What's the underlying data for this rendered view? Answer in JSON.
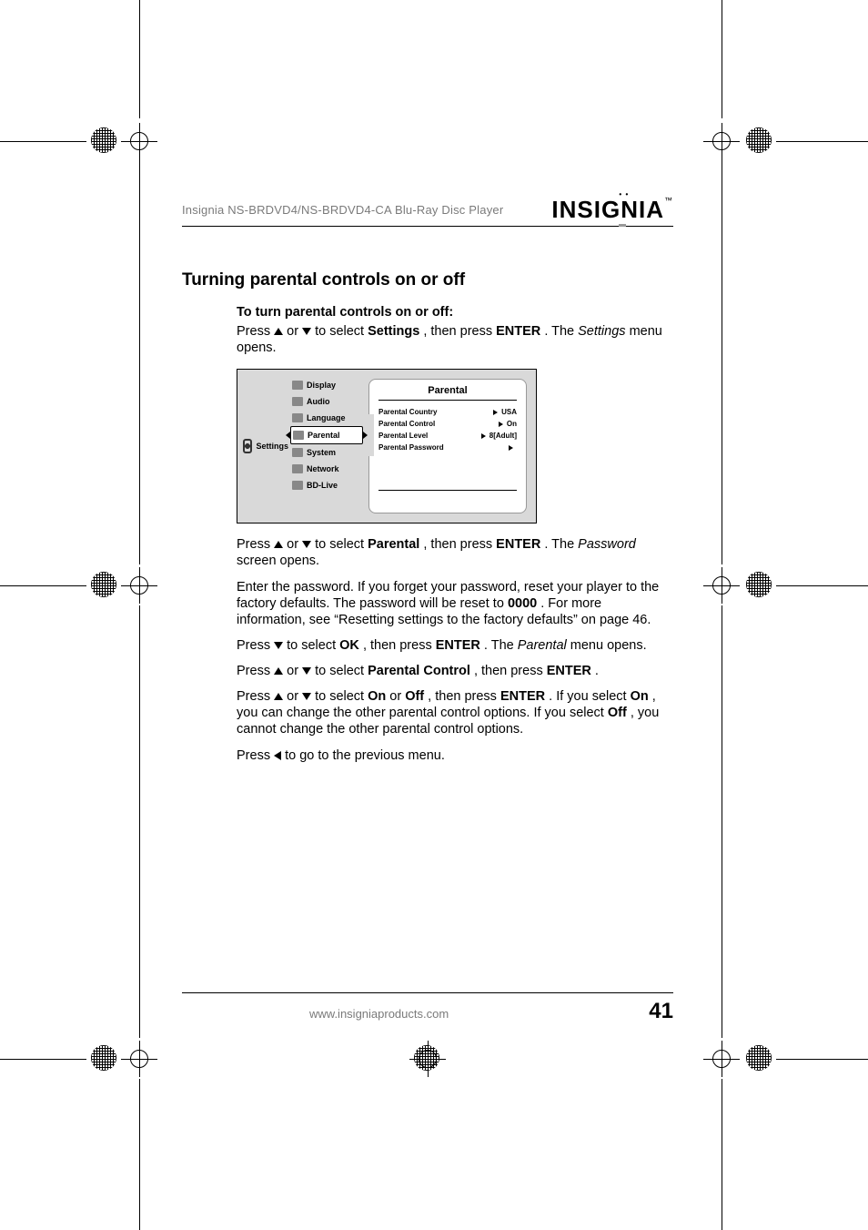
{
  "header": {
    "product_line": "Insignia NS-BRDVD4/NS-BRDVD4-CA Blu-Ray Disc Player",
    "brand": "INSIGNIA"
  },
  "section_title": "Turning parental controls on or off",
  "procedure_title": "To turn parental controls on or off:",
  "steps": {
    "s1a": "Press ",
    "s1b": " or ",
    "s1c": " to select ",
    "s1_settings": "Settings",
    "s1d": ", then press ",
    "s1_enter": "ENTER",
    "s1e": ". The ",
    "s1_settings_i": "Settings",
    "s1f": " menu opens.",
    "s2a": "Press ",
    "s2b": " or ",
    "s2c": " to select ",
    "s2_parental": "Parental",
    "s2d": ", then press ",
    "s2_enter": "ENTER",
    "s2e": ". The ",
    "s2_password_i": "Password",
    "s2f": " screen opens.",
    "s3a": "Enter the password. If you forget your password, reset your player to the factory defaults. The password will be reset to ",
    "s3_zeros": "0000",
    "s3b": ". For more information, see “Resetting settings to the factory defaults” on page 46.",
    "s4a": "Press ",
    "s4b": " to select ",
    "s4_ok": "OK",
    "s4c": ", then press ",
    "s4_enter": "ENTER",
    "s4d": ". The ",
    "s4_parental_i": "Parental",
    "s4e": " menu opens.",
    "s5a": "Press ",
    "s5b": " or ",
    "s5c": " to select ",
    "s5_pc": "Parental Control",
    "s5d": ", then press ",
    "s5_enter": "ENTER",
    "s5e": ".",
    "s6a": "Press ",
    "s6b": " or ",
    "s6c": " to select ",
    "s6_on": "On",
    "s6d": " or ",
    "s6_off": "Off",
    "s6e": ", then press ",
    "s6_enter": "ENTER",
    "s6f": ". If you select ",
    "s6_on2": "On",
    "s6g": ", you can change the other parental control options. If you select ",
    "s6_off2": "Off",
    "s6h": ", you cannot change the other parental control options.",
    "s7a": "Press ",
    "s7b": " to go to the previous menu."
  },
  "menu": {
    "left_label": "Settings",
    "items": [
      "Display",
      "Audio",
      "Language",
      "Parental",
      "System",
      "Network",
      "BD-Live"
    ],
    "panel_title": "Parental",
    "rows": [
      {
        "label": "Parental Country",
        "value": "USA"
      },
      {
        "label": "Parental Control",
        "value": "On"
      },
      {
        "label": "Parental Level",
        "value": "8[Adult]"
      },
      {
        "label": "Parental Password",
        "value": ""
      }
    ]
  },
  "footer": {
    "url": "www.insigniaproducts.com",
    "page": "41"
  }
}
